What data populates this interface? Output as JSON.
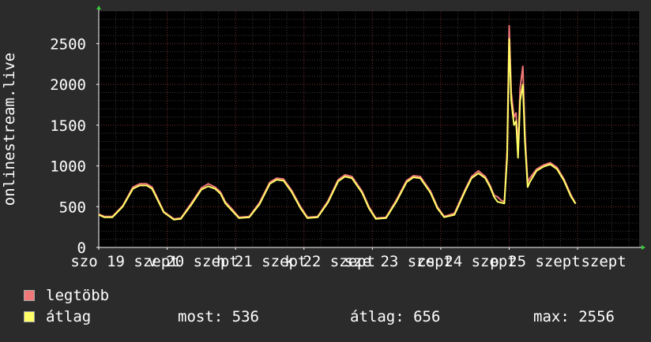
{
  "chart_data": {
    "type": "line",
    "ylabel": "onlinestream.live",
    "ylim": [
      0,
      2900
    ],
    "y_ticks": [
      0,
      500,
      1000,
      1500,
      2000,
      2500
    ],
    "y_tick_labels": [
      "0",
      "500",
      "1000",
      "1500",
      "2000",
      "2500"
    ],
    "x_range_days": [
      0,
      7.9
    ],
    "x_ticks": [
      0,
      1,
      2,
      3,
      4,
      5,
      6,
      7
    ],
    "x_tick_labels": [
      "szo 19 szept",
      "v 20 szept",
      "h 21 szept",
      "k 22 szept",
      "sze 23 szept",
      "cs 24 szept",
      "p 25 szept",
      "szept"
    ],
    "grid": true,
    "legend_position": "bottom-left",
    "series": [
      {
        "name": "legtöbb",
        "color": "#f07878",
        "points": [
          [
            0,
            410
          ],
          [
            0.08,
            380
          ],
          [
            0.2,
            380
          ],
          [
            0.35,
            510
          ],
          [
            0.5,
            740
          ],
          [
            0.6,
            780
          ],
          [
            0.7,
            780
          ],
          [
            0.78,
            740
          ],
          [
            0.85,
            620
          ],
          [
            0.95,
            440
          ],
          [
            1.1,
            350
          ],
          [
            1.2,
            360
          ],
          [
            1.35,
            540
          ],
          [
            1.5,
            730
          ],
          [
            1.6,
            780
          ],
          [
            1.7,
            740
          ],
          [
            1.78,
            680
          ],
          [
            1.85,
            560
          ],
          [
            1.95,
            470
          ],
          [
            2.05,
            370
          ],
          [
            2.2,
            380
          ],
          [
            2.35,
            550
          ],
          [
            2.5,
            800
          ],
          [
            2.6,
            850
          ],
          [
            2.7,
            840
          ],
          [
            2.82,
            700
          ],
          [
            2.95,
            500
          ],
          [
            3.05,
            370
          ],
          [
            3.2,
            380
          ],
          [
            3.35,
            570
          ],
          [
            3.5,
            830
          ],
          [
            3.6,
            890
          ],
          [
            3.7,
            870
          ],
          [
            3.85,
            690
          ],
          [
            3.95,
            500
          ],
          [
            4.05,
            360
          ],
          [
            4.2,
            370
          ],
          [
            4.35,
            580
          ],
          [
            4.5,
            820
          ],
          [
            4.6,
            880
          ],
          [
            4.7,
            870
          ],
          [
            4.85,
            690
          ],
          [
            4.95,
            500
          ],
          [
            5.05,
            380
          ],
          [
            5.2,
            420
          ],
          [
            5.35,
            700
          ],
          [
            5.45,
            870
          ],
          [
            5.55,
            940
          ],
          [
            5.65,
            870
          ],
          [
            5.72,
            760
          ],
          [
            5.78,
            640
          ],
          [
            5.83,
            620
          ],
          [
            5.88,
            580
          ],
          [
            5.93,
            560
          ],
          [
            5.97,
            1200
          ],
          [
            6.0,
            2720
          ],
          [
            6.03,
            1900
          ],
          [
            6.07,
            1600
          ],
          [
            6.1,
            1650
          ],
          [
            6.13,
            1200
          ],
          [
            6.16,
            1950
          ],
          [
            6.2,
            2220
          ],
          [
            6.23,
            1400
          ],
          [
            6.27,
            800
          ],
          [
            6.3,
            850
          ],
          [
            6.4,
            960
          ],
          [
            6.5,
            1010
          ],
          [
            6.6,
            1040
          ],
          [
            6.7,
            980
          ],
          [
            6.8,
            840
          ],
          [
            6.9,
            650
          ],
          [
            6.97,
            540
          ]
        ]
      },
      {
        "name": "átlag",
        "color": "#ffff66",
        "points": [
          [
            0,
            400
          ],
          [
            0.08,
            370
          ],
          [
            0.2,
            370
          ],
          [
            0.35,
            500
          ],
          [
            0.5,
            720
          ],
          [
            0.6,
            760
          ],
          [
            0.7,
            760
          ],
          [
            0.78,
            720
          ],
          [
            0.85,
            600
          ],
          [
            0.95,
            430
          ],
          [
            1.1,
            340
          ],
          [
            1.2,
            350
          ],
          [
            1.35,
            520
          ],
          [
            1.5,
            710
          ],
          [
            1.6,
            750
          ],
          [
            1.7,
            720
          ],
          [
            1.78,
            660
          ],
          [
            1.85,
            540
          ],
          [
            1.95,
            450
          ],
          [
            2.05,
            360
          ],
          [
            2.2,
            370
          ],
          [
            2.35,
            530
          ],
          [
            2.5,
            780
          ],
          [
            2.6,
            830
          ],
          [
            2.7,
            820
          ],
          [
            2.82,
            680
          ],
          [
            2.95,
            480
          ],
          [
            3.05,
            360
          ],
          [
            3.2,
            370
          ],
          [
            3.35,
            550
          ],
          [
            3.5,
            810
          ],
          [
            3.6,
            870
          ],
          [
            3.7,
            850
          ],
          [
            3.85,
            670
          ],
          [
            3.95,
            480
          ],
          [
            4.05,
            350
          ],
          [
            4.2,
            360
          ],
          [
            4.35,
            560
          ],
          [
            4.5,
            800
          ],
          [
            4.6,
            860
          ],
          [
            4.7,
            850
          ],
          [
            4.85,
            670
          ],
          [
            4.95,
            480
          ],
          [
            5.05,
            370
          ],
          [
            5.2,
            400
          ],
          [
            5.35,
            680
          ],
          [
            5.45,
            850
          ],
          [
            5.55,
            910
          ],
          [
            5.65,
            850
          ],
          [
            5.72,
            740
          ],
          [
            5.78,
            620
          ],
          [
            5.83,
            560
          ],
          [
            5.88,
            550
          ],
          [
            5.93,
            540
          ],
          [
            5.97,
            1100
          ],
          [
            6.0,
            2556
          ],
          [
            6.03,
            1800
          ],
          [
            6.07,
            1500
          ],
          [
            6.1,
            1550
          ],
          [
            6.13,
            1100
          ],
          [
            6.16,
            1800
          ],
          [
            6.2,
            2000
          ],
          [
            6.23,
            1300
          ],
          [
            6.27,
            740
          ],
          [
            6.3,
            800
          ],
          [
            6.4,
            940
          ],
          [
            6.5,
            990
          ],
          [
            6.6,
            1020
          ],
          [
            6.7,
            960
          ],
          [
            6.8,
            820
          ],
          [
            6.9,
            630
          ],
          [
            6.97,
            536
          ]
        ]
      }
    ]
  },
  "legend": {
    "items": [
      {
        "label": "legtöbb",
        "color": "#f07878"
      },
      {
        "label": "átlag",
        "color": "#ffff66"
      }
    ]
  },
  "stats": {
    "now_label": "most:",
    "now_value": "536",
    "avg_label": "átlag:",
    "avg_value": "656",
    "max_label": "max:",
    "max_value": "2556"
  }
}
